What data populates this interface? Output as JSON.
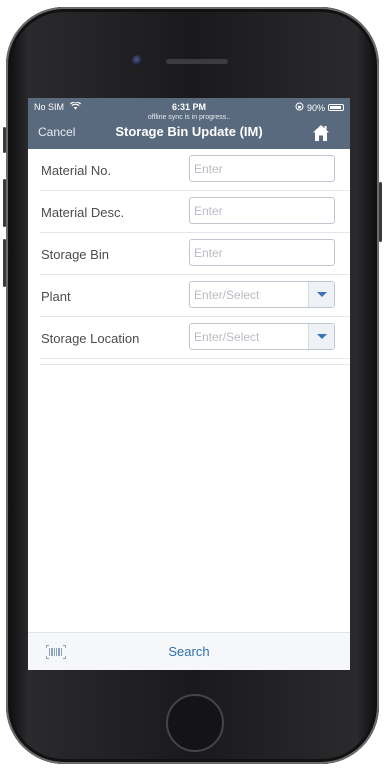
{
  "status_bar": {
    "carrier": "No SIM",
    "time": "6:31 PM",
    "battery": "90%"
  },
  "header": {
    "sync_note": "offline sync is in progress..",
    "cancel_label": "Cancel",
    "title": "Storage Bin Update (IM)"
  },
  "form": {
    "fields": [
      {
        "label": "Material No.",
        "placeholder": "Enter"
      },
      {
        "label": "Material Desc.",
        "placeholder": "Enter"
      },
      {
        "label": "Storage Bin",
        "placeholder": "Enter"
      },
      {
        "label": "Plant",
        "placeholder": "Enter/Select"
      },
      {
        "label": "Storage Location",
        "placeholder": "Enter/Select"
      }
    ]
  },
  "footer": {
    "search_label": "Search"
  },
  "colors": {
    "header_bg": "#5a6a7e",
    "accent": "#2f6fb0"
  },
  "icons": [
    "wifi-icon",
    "lock-rotation-icon",
    "battery-icon",
    "home-icon",
    "chevron-down-icon",
    "barcode-icon"
  ]
}
